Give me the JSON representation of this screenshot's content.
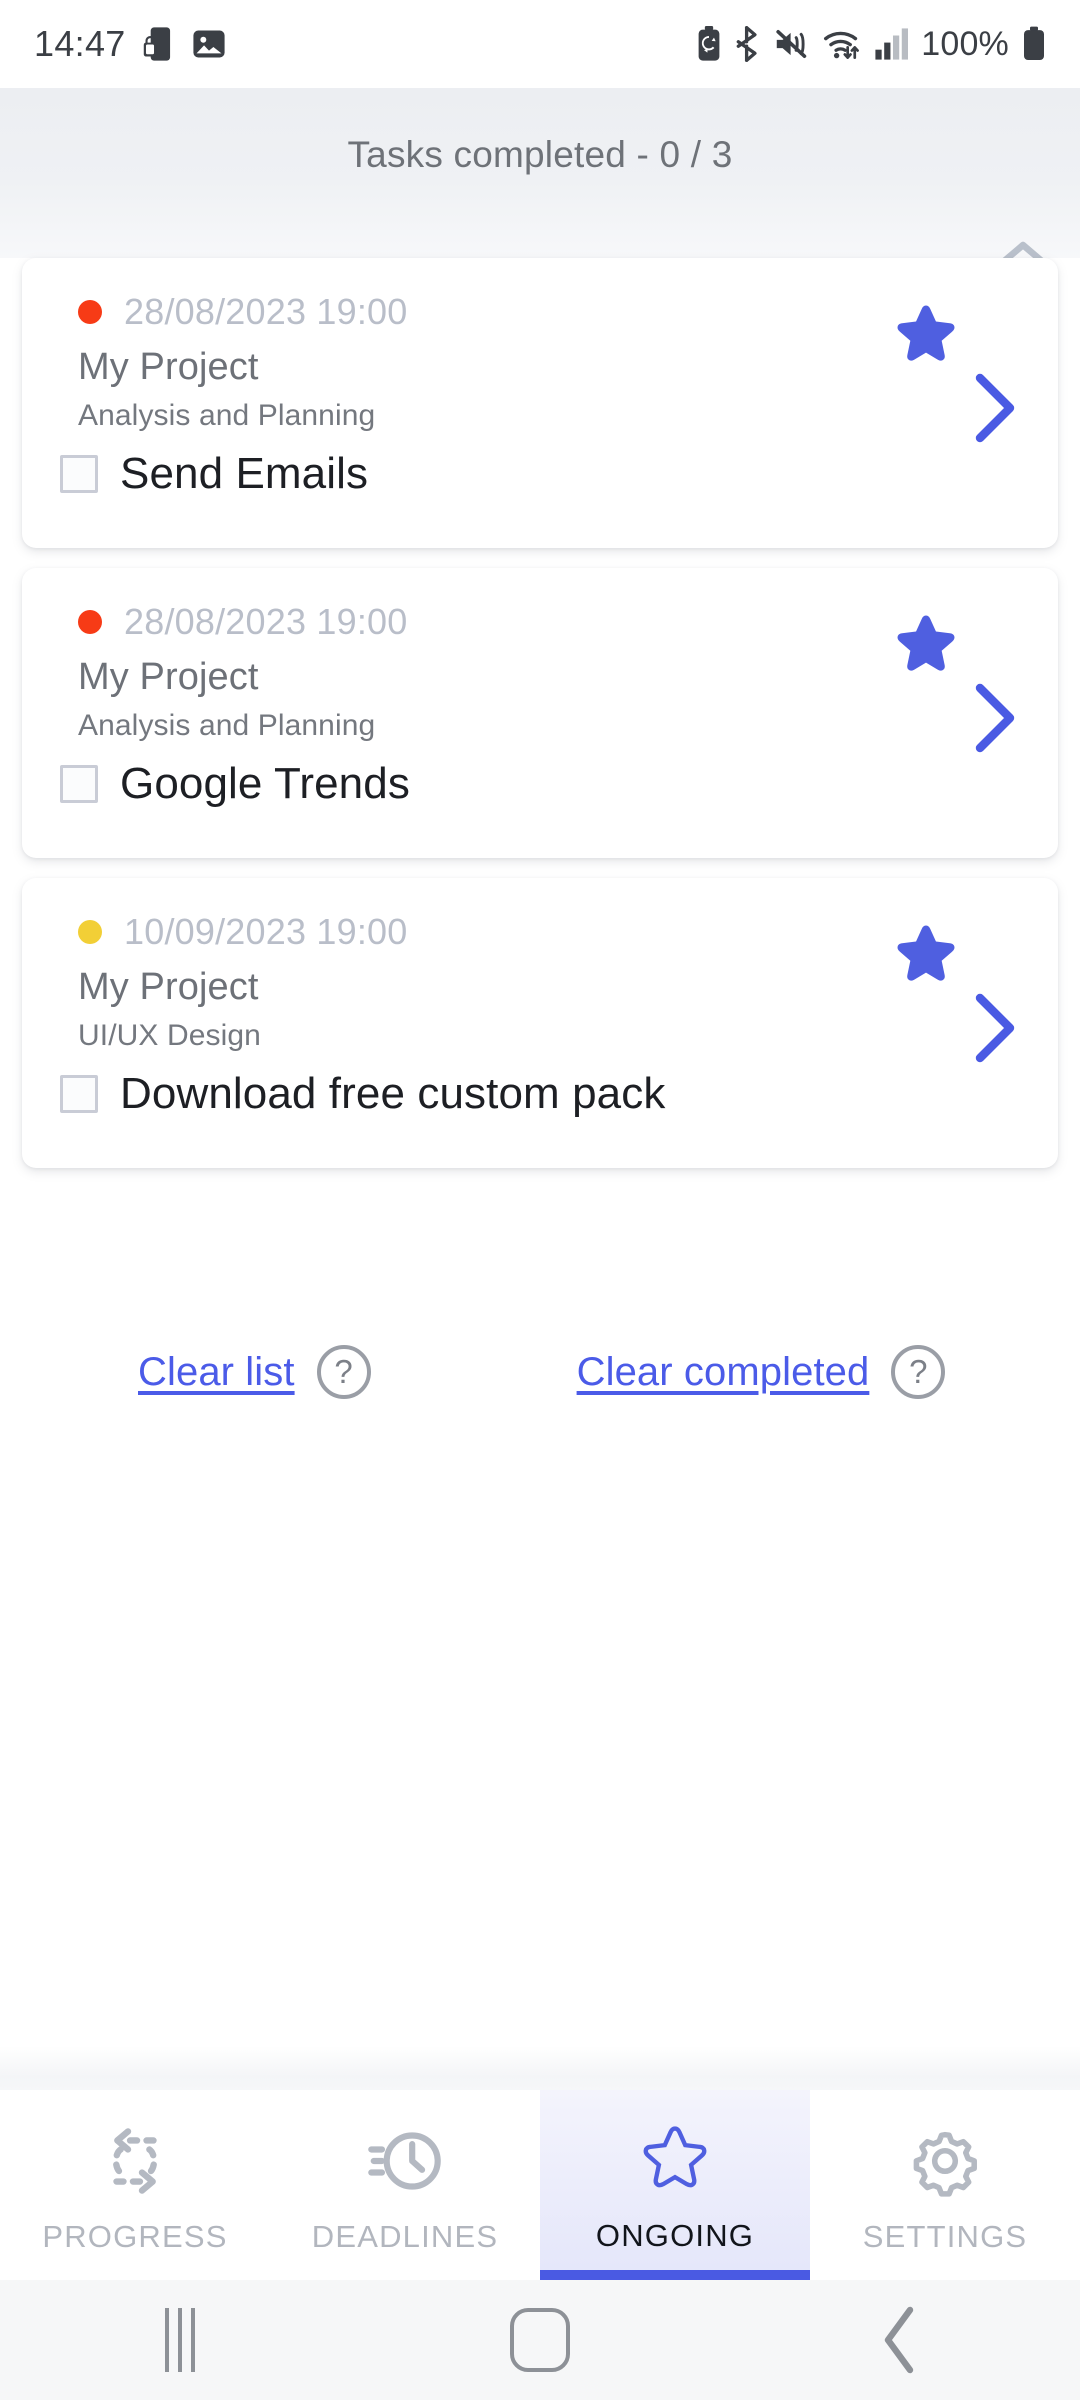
{
  "statusbar": {
    "time": "14:47",
    "battery_percent": "100%",
    "left_icons": [
      "nfc-lock-icon",
      "gallery-image-icon"
    ],
    "right_icons": [
      "battery-saver-icon",
      "bluetooth-icon",
      "sound-mute-icon",
      "wifi-icon",
      "signal-bars-icon",
      "battery-icon"
    ]
  },
  "header": {
    "title": "Tasks completed - 0 / 3",
    "completed": 0,
    "total": 3,
    "progress_percent": 0,
    "sort_icon": "sort-updown-icon",
    "track_color": "#c7cbeb"
  },
  "tasks": [
    {
      "dot_color": "#f73b16",
      "date": "28/08/2023 19:00",
      "project": "My Project",
      "category": "Analysis and Planning",
      "title": "Send Emails",
      "checked": false,
      "starred": true,
      "star_icon": "star-filled-icon",
      "chevron_icon": "chevron-right-icon"
    },
    {
      "dot_color": "#f73b16",
      "date": "28/08/2023 19:00",
      "project": "My Project",
      "category": "Analysis and Planning",
      "title": "Google Trends",
      "checked": false,
      "starred": true,
      "star_icon": "star-filled-icon",
      "chevron_icon": "chevron-right-icon"
    },
    {
      "dot_color": "#f2cf36",
      "date": "10/09/2023 19:00",
      "project": "My Project",
      "category": "UI/UX Design",
      "title": "Download free custom pack",
      "checked": false,
      "starred": true,
      "star_icon": "star-filled-icon",
      "chevron_icon": "chevron-right-icon"
    }
  ],
  "actions": {
    "clear_list_label": "Clear list",
    "clear_list_help": "?",
    "clear_completed_label": "Clear completed",
    "clear_completed_help": "?",
    "link_color": "#4b5be8"
  },
  "tabs": [
    {
      "label": "PROGRESS",
      "icon": "swap-arrows-icon",
      "active": false
    },
    {
      "label": "DEADLINES",
      "icon": "clock-speed-icon",
      "active": false
    },
    {
      "label": "ONGOING",
      "icon": "star-outline-icon",
      "active": true
    },
    {
      "label": "SETTINGS",
      "icon": "gear-icon",
      "active": false
    }
  ],
  "navbar": {
    "recents_icon": "recents-icon",
    "home_icon": "home-icon",
    "back_icon": "back-icon"
  },
  "colors": {
    "accent": "#4f5fe0",
    "active_tab_text": "#12151b",
    "inactive_tab_text": "#b2b6be"
  }
}
